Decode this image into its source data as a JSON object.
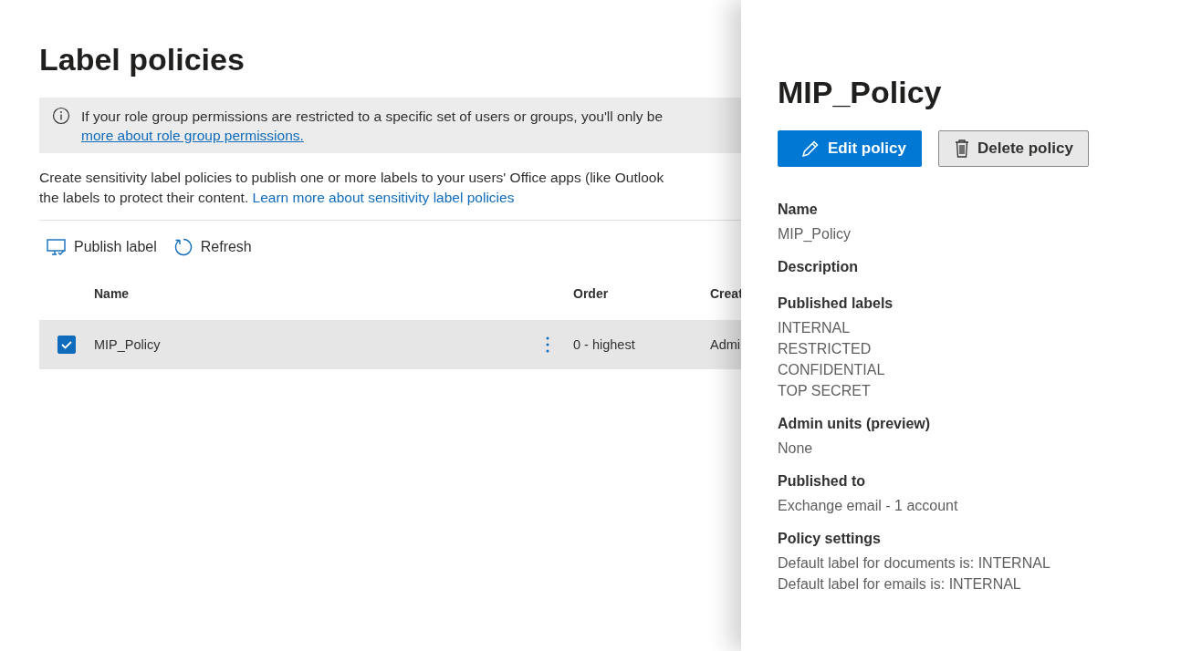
{
  "page": {
    "title": "Label policies"
  },
  "banner": {
    "text": "If your role group permissions are restricted to a specific set of users or groups, you'll only be",
    "link": "more about role group permissions."
  },
  "description": {
    "lines": [
      "Create sensitivity label policies to publish one or more labels to your users' Office apps (like Outlook",
      "the labels to protect their content."
    ],
    "link": "Learn more about sensitivity label policies"
  },
  "toolbar": [
    {
      "kind": "publish",
      "label": "Publish label"
    },
    {
      "kind": "refresh",
      "label": "Refresh"
    }
  ],
  "table": {
    "columns": [
      "Name",
      "Order",
      "Creat"
    ],
    "rows": [
      {
        "selected": true,
        "cells": [
          "MIP_Policy",
          "0 - highest",
          "Admi"
        ]
      }
    ]
  },
  "panel": {
    "title": "MIP_Policy",
    "buttons": [
      {
        "kind": "primary",
        "label": "Edit policy"
      },
      {
        "kind": "default",
        "label": "Delete policy"
      }
    ],
    "fields": [
      {
        "label": "Name",
        "values": [
          "MIP_Policy"
        ]
      },
      {
        "label": "Description"
      },
      {
        "label": "Published labels",
        "values": [
          "INTERNAL",
          "RESTRICTED",
          "CONFIDENTIAL",
          "TOP SECRET"
        ]
      },
      {
        "label": "Admin units (preview)",
        "values": [
          "None"
        ]
      },
      {
        "label": "Published to",
        "values": [
          "Exchange email - 1 account"
        ]
      },
      {
        "label": "Policy settings",
        "values": [
          "Default label for documents is: INTERNAL",
          "Default label for emails is: INTERNAL"
        ]
      }
    ]
  }
}
